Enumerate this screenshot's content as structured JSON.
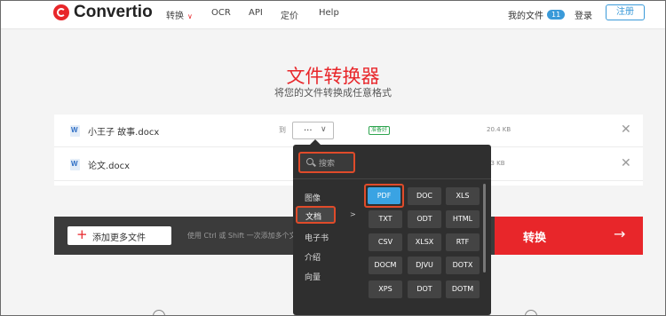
{
  "header": {
    "brand": "Convertio",
    "nav": [
      {
        "label": "转换",
        "caret": "∨"
      },
      {
        "label": "OCR"
      },
      {
        "label": "API"
      },
      {
        "label": "定价"
      },
      {
        "label": "Help"
      }
    ],
    "my_files_label": "我的文件",
    "my_files_count": "11",
    "login_label": "登录",
    "register_label": "注册"
  },
  "hero": {
    "title": "文件转换器",
    "subtitle": "将您的文件转换成任意格式"
  },
  "files": [
    {
      "name": "小王子 故事.docx",
      "to_label": "到",
      "select_value": "...",
      "status": "准备好",
      "size": "20.4 KB"
    },
    {
      "name": "论文.docx",
      "size": "33 KB"
    }
  ],
  "actionbar": {
    "add_label": "添加更多文件",
    "hint": "使用 Ctrl 或 Shift 一次添加多个文",
    "convert_label": "转换"
  },
  "popup": {
    "search_placeholder": "搜索",
    "categories": [
      {
        "label": "图像"
      },
      {
        "label": "文档",
        "active": true
      },
      {
        "label": "电子书"
      },
      {
        "label": "介绍"
      },
      {
        "label": "向量"
      }
    ],
    "formats": [
      [
        "PDF",
        "DOC",
        "XLS"
      ],
      [
        "TXT",
        "ODT",
        "HTML"
      ],
      [
        "CSV",
        "XLSX",
        "RTF"
      ],
      [
        "DOCM",
        "DJVU",
        "DOTX"
      ],
      [
        "XPS",
        "DOT",
        "DOTM"
      ]
    ],
    "selected_format": "PDF"
  },
  "colors": {
    "brand_red": "#e8262a",
    "accent_blue": "#3a9ad9",
    "highlight_orange": "#e04b2a",
    "selected_format_blue": "#3aa3e3",
    "popup_bg": "#2f2f2f"
  }
}
